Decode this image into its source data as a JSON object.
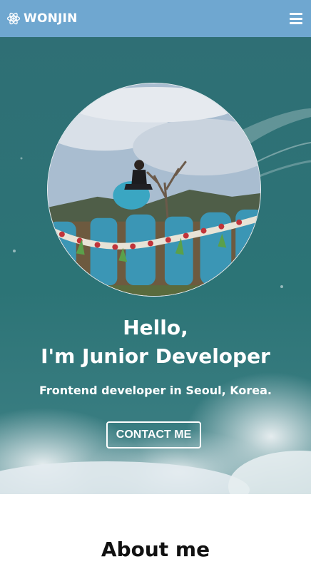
{
  "navbar": {
    "logo_text": "WONJIN",
    "logo_icon": "react-atom-icon",
    "menu_icon": "hamburger-icon"
  },
  "home": {
    "title_line1": "Hello,",
    "title_line2": "I'm Junior Developer",
    "description": "Frontend developer in Seoul, Korea.",
    "contact_label": "CONTACT ME",
    "avatar_alt": "profile-photo"
  },
  "about": {
    "title": "About me"
  },
  "colors": {
    "navbar": "#6fa7d0",
    "hero_bg": "#2d7274",
    "text_light": "#ffffff",
    "text_dark": "#111111"
  }
}
